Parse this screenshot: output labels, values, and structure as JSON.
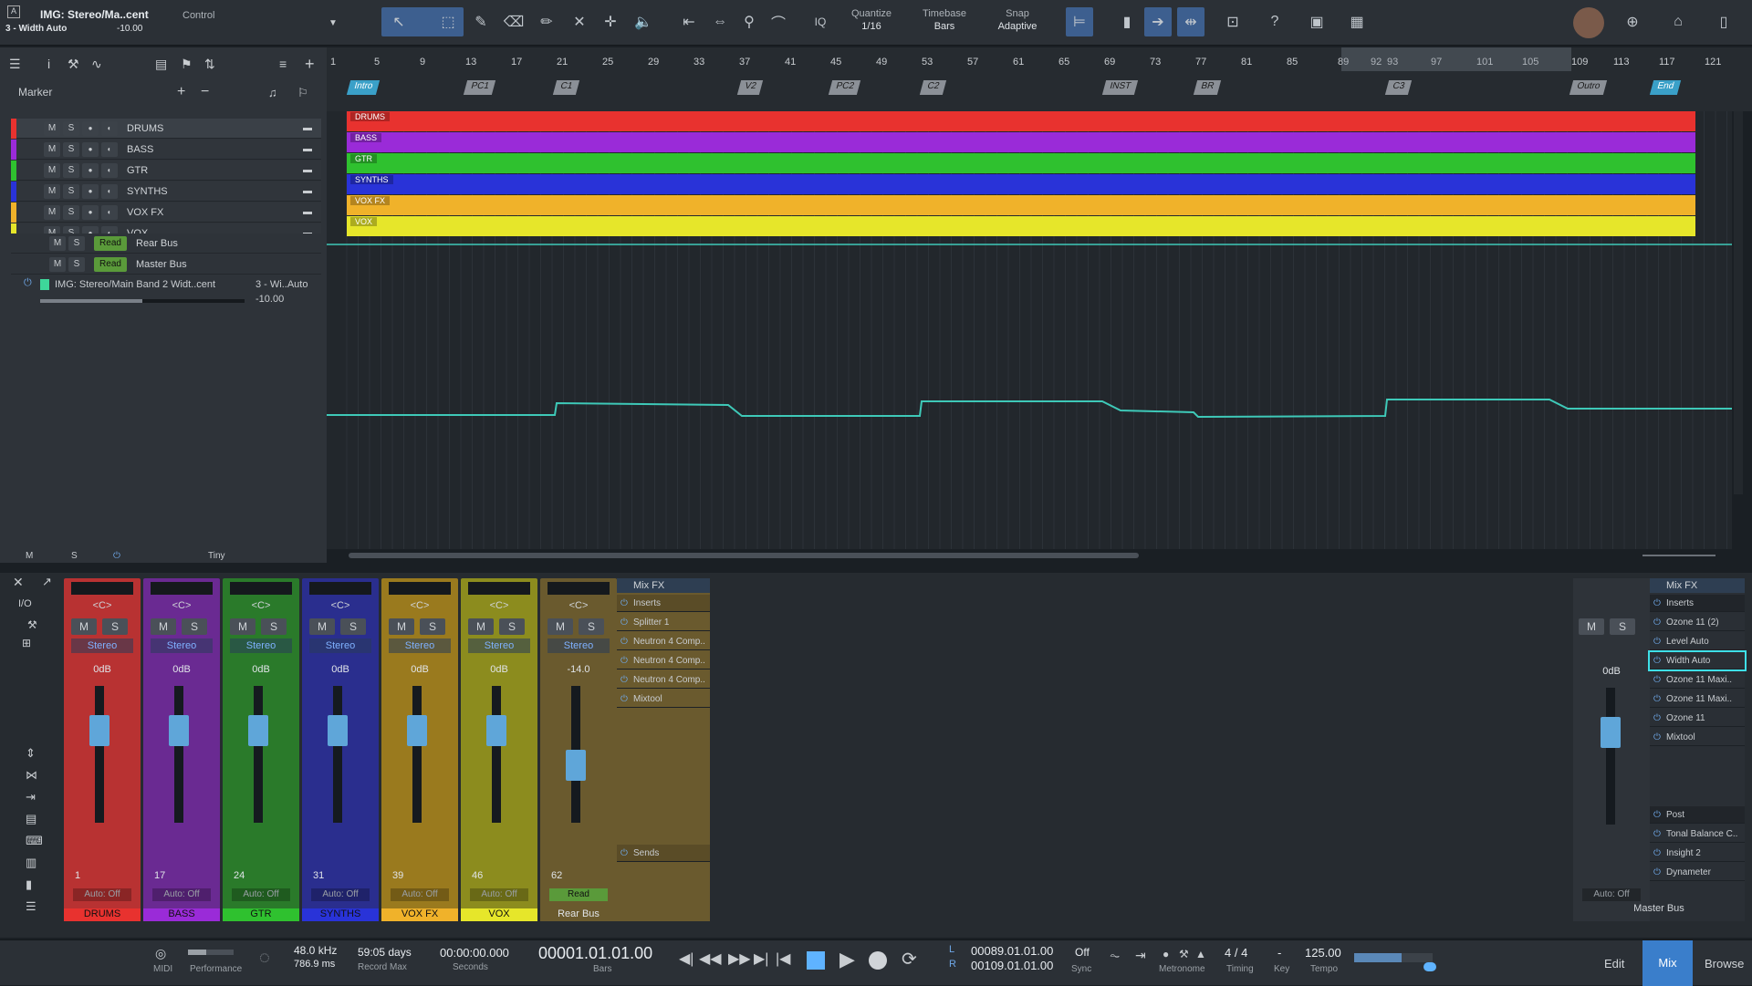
{
  "toolbar": {
    "track_name": "IMG: Stereo/Ma..cent",
    "track_param": "3 - Width Auto",
    "track_value": "-10.00",
    "control": "Control",
    "quantize_label": "Quantize",
    "quantize_value": "1/16",
    "timebase_label": "Timebase",
    "timebase_value": "Bars",
    "snap_label": "Snap",
    "snap_value": "Adaptive",
    "iq": "IQ"
  },
  "track_panel": {
    "marker": "Marker",
    "tracks": [
      {
        "name": "DRUMS",
        "color": "#e8322f"
      },
      {
        "name": "BASS",
        "color": "#9a2bd8"
      },
      {
        "name": "GTR",
        "color": "#2fc12f"
      },
      {
        "name": "SYNTHS",
        "color": "#2933d8"
      },
      {
        "name": "VOX FX",
        "color": "#f0b22a"
      },
      {
        "name": "VOX",
        "color": "#e6e62a"
      }
    ],
    "rear_bus": "Rear Bus",
    "master_bus": "Master Bus",
    "read": "Read",
    "auto_track": "IMG: Stereo/Main Band 2 Widt..cent",
    "auto_param": "3 - Wi..Auto",
    "auto_value": "-10.00",
    "footer_size": "Tiny"
  },
  "ruler": {
    "bars": [
      "1",
      "5",
      "9",
      "13",
      "17",
      "21",
      "25",
      "29",
      "33",
      "37",
      "41",
      "45",
      "49",
      "53",
      "57",
      "61",
      "65",
      "69",
      "73",
      "77",
      "81",
      "85",
      "89",
      "92",
      "93",
      "97",
      "101",
      "105",
      "109",
      "113",
      "117",
      "121"
    ],
    "markers": [
      "Intro",
      "PC1",
      "C1",
      "V2",
      "PC2",
      "C2",
      "INST",
      "BR",
      "C3",
      "Outro",
      "End"
    ]
  },
  "mixer": {
    "channels": [
      {
        "name": "DRUMS",
        "num": "1",
        "db": "0dB",
        "color": "#b83232"
      },
      {
        "name": "BASS",
        "num": "17",
        "db": "0dB",
        "color": "#6a2a92"
      },
      {
        "name": "GTR",
        "num": "24",
        "db": "0dB",
        "color": "#2a7a2a"
      },
      {
        "name": "SYNTHS",
        "num": "31",
        "db": "0dB",
        "color": "#2a2e8e"
      },
      {
        "name": "VOX FX",
        "num": "39",
        "db": "0dB",
        "color": "#9a7a1e"
      },
      {
        "name": "VOX",
        "num": "46",
        "db": "0dB",
        "color": "#8c8c1e"
      },
      {
        "name": "Rear Bus",
        "num": "62",
        "db": "-14.0",
        "color": "#6a5a2e"
      }
    ],
    "pan": "<C>",
    "stereo": "Stereo",
    "auto_off": "Auto: Off",
    "mixfx": "Mix FX",
    "inserts": "Inserts",
    "sends": "Sends",
    "rear_inserts": [
      "Splitter 1",
      "Neutron 4 Comp..",
      "Neutron 4 Comp..",
      "Neutron 4 Comp..",
      "Mixtool"
    ],
    "master_inserts": [
      "Ozone 11 (2)",
      "Level Auto",
      "Width Auto",
      "Ozone 11 Maxi..",
      "Ozone 11 Maxi..",
      "Ozone 11",
      "Mixtool"
    ],
    "post": "Post",
    "post_inserts": [
      "Tonal Balance C..",
      "Insight 2",
      "Dynameter"
    ],
    "master_label": "Master Bus",
    "master_db": "0dB",
    "io": "I/O"
  },
  "transport": {
    "midi": "MIDI",
    "performance": "Performance",
    "rate": "48.0 kHz",
    "latency": "786.9 ms",
    "days": "59:05 days",
    "record_max": "Record Max",
    "time": "00:00:00.000",
    "seconds": "Seconds",
    "bars_pos": "00001.01.01.00",
    "bars": "Bars",
    "loop_l": "00089.01.01.00",
    "loop_r": "00109.01.01.00",
    "sync_off": "Off",
    "sync": "Sync",
    "metronome": "Metronome",
    "sig": "4 / 4",
    "timing": "Timing",
    "key_dash": "-",
    "key": "Key",
    "tempo_val": "125.00",
    "tempo": "Tempo",
    "edit": "Edit",
    "mix": "Mix",
    "browse": "Browse"
  }
}
